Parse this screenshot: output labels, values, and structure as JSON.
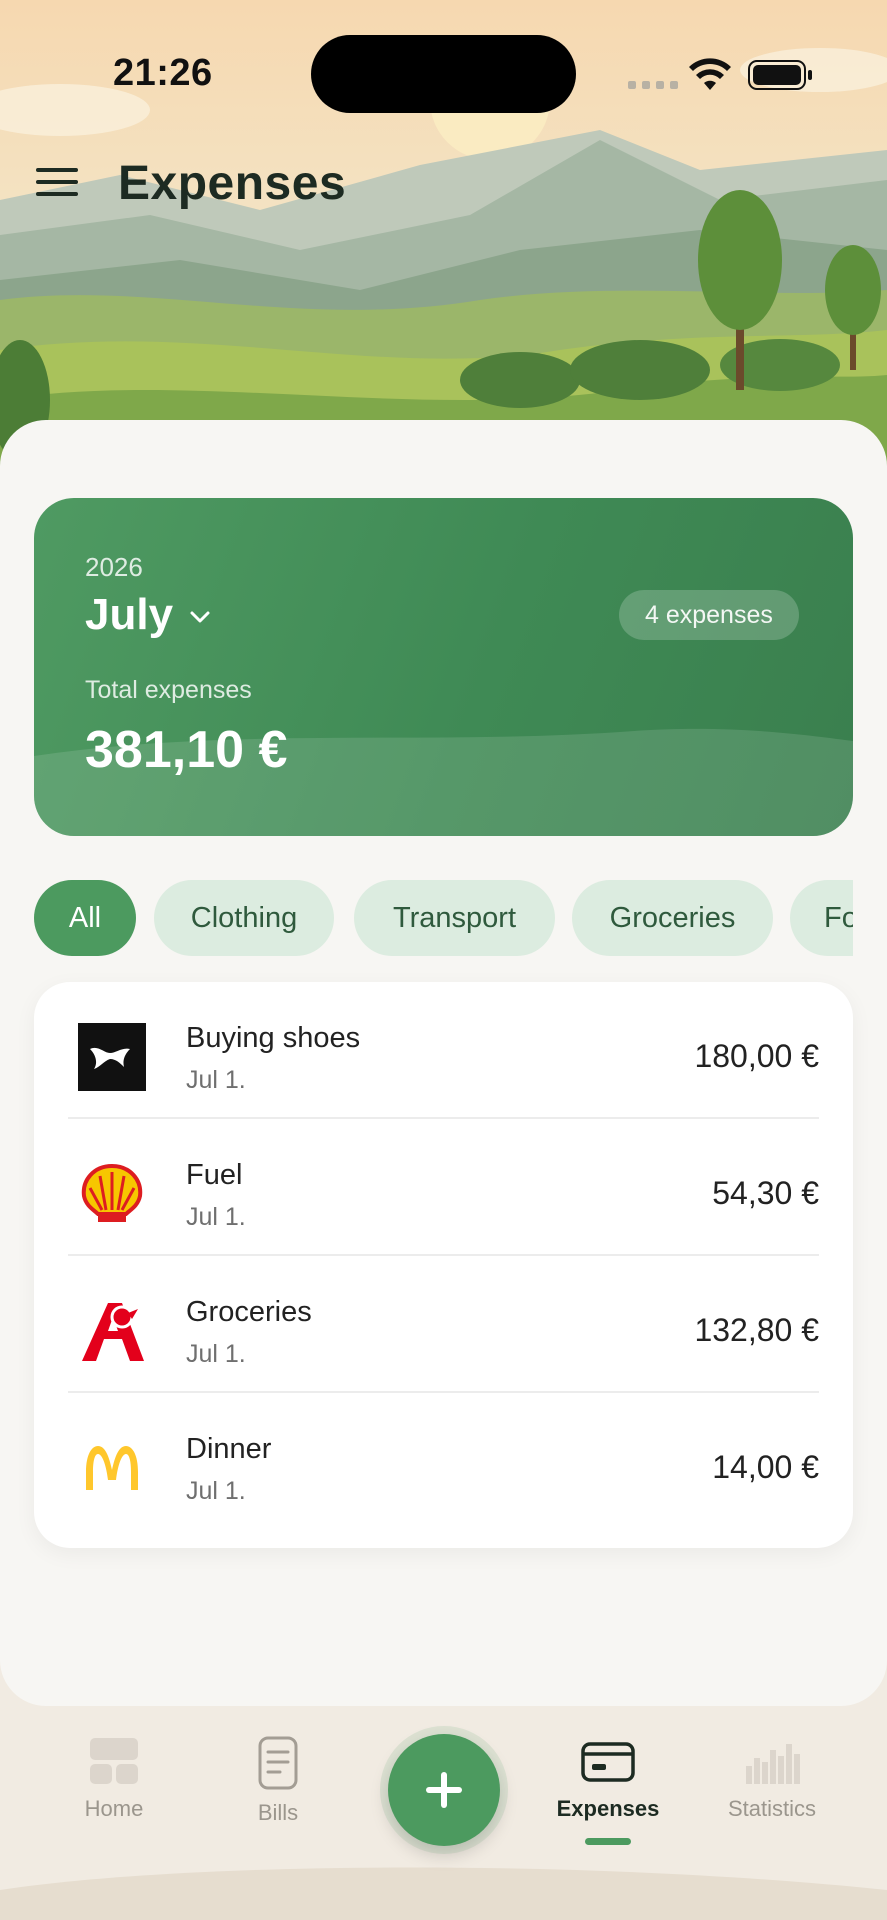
{
  "status_bar": {
    "time": "21:26"
  },
  "header": {
    "title": "Expenses"
  },
  "summary": {
    "year": "2026",
    "month": "July",
    "count_badge": "4 expenses",
    "total_label": "Total expenses",
    "total_value": "381,10 €"
  },
  "filters": [
    {
      "label": "All",
      "active": true
    },
    {
      "label": "Clothing",
      "active": false
    },
    {
      "label": "Transport",
      "active": false
    },
    {
      "label": "Groceries",
      "active": false
    },
    {
      "label": "Fo",
      "active": false
    }
  ],
  "expenses": [
    {
      "name": "Buying shoes",
      "date": "Jul 1.",
      "amount": "180,00 €",
      "logo_icon": "puma-logo"
    },
    {
      "name": "Fuel",
      "date": "Jul 1.",
      "amount": "54,30 €",
      "logo_icon": "shell-logo"
    },
    {
      "name": "Groceries",
      "date": "Jul 1.",
      "amount": "132,80 €",
      "logo_icon": "auchan-logo"
    },
    {
      "name": "Dinner",
      "date": "Jul 1.",
      "amount": "14,00 €",
      "logo_icon": "mcdonalds-logo"
    }
  ],
  "nav": {
    "items": [
      {
        "label": "Home",
        "icon": "home-icon",
        "active": false
      },
      {
        "label": "Bills",
        "icon": "bill-icon",
        "active": false
      },
      {
        "label": "Expenses",
        "icon": "card-icon",
        "active": true
      },
      {
        "label": "Statistics",
        "icon": "chart-icon",
        "active": false
      }
    ],
    "fab_icon": "plus-icon"
  },
  "colors": {
    "accent": "#4c9a5f",
    "background": "#f7f6f3",
    "sand": "#f1ebe2"
  }
}
